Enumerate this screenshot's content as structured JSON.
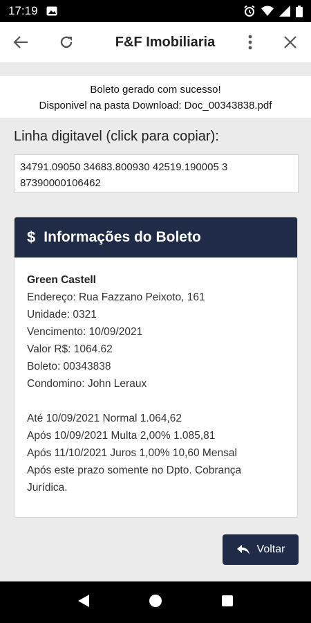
{
  "status": {
    "time": "17:19"
  },
  "toolbar": {
    "title": "F&F Imobiliaria"
  },
  "message": {
    "line1": "Boleto gerado com sucesso!",
    "line2": "Disponivel na pasta Download: Doc_00343838.pdf"
  },
  "linha": {
    "label": "Linha digitavel (click para copiar):",
    "value": "34791.09050 34683.800930 42519.190005 3 87390000106462"
  },
  "card": {
    "symbol": "$",
    "title": "Informações do Boleto",
    "name": "Green Castell",
    "details": [
      "Endereço: Rua Fazzano Peixoto, 161",
      "Unidade: 0321",
      "Vencimento: 10/09/2021",
      "Valor R$: 1064.62",
      "Boleto: 00343838",
      "Condomino: John Leraux"
    ],
    "terms": [
      "Até 10/09/2021 Normal 1.064,62",
      "Após 10/09/2021 Multa 2,00% 1.085,81",
      "Após 11/10/2021 Juros 1,00% 10,60 Mensal",
      "Após este prazo somente no Dpto. Cobrança Jurídica."
    ]
  },
  "voltar": {
    "label": "Voltar"
  }
}
